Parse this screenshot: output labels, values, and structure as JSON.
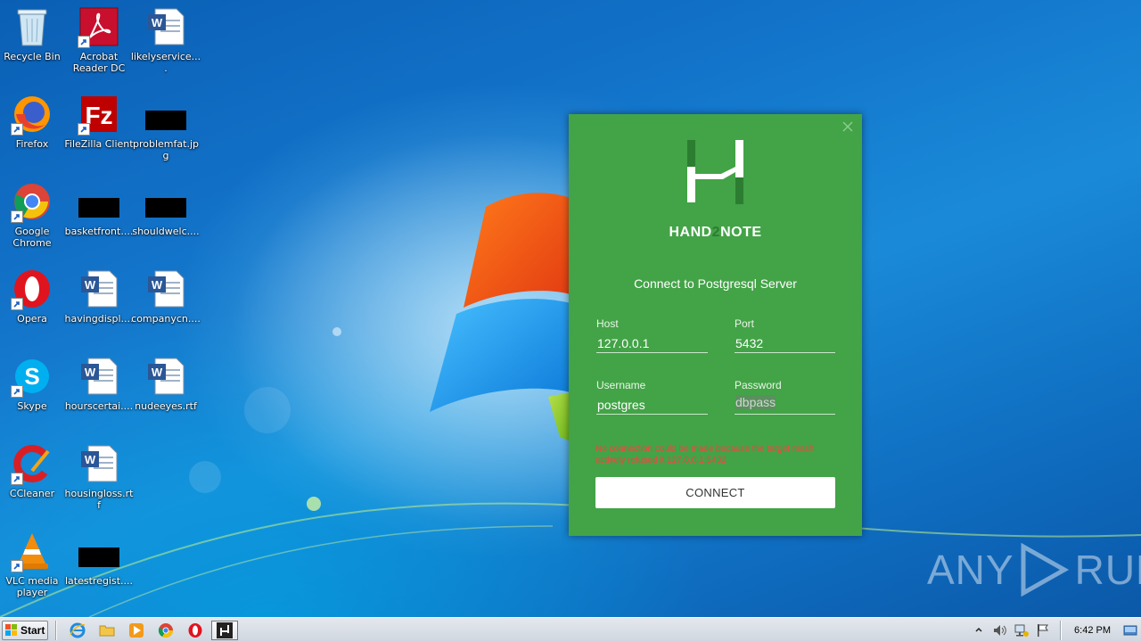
{
  "desktop": {
    "icons": [
      {
        "label": "Recycle Bin"
      },
      {
        "label": "Acrobat Reader DC"
      },
      {
        "label": "likelyservice...."
      },
      {
        "label": "Firefox"
      },
      {
        "label": "FileZilla Client"
      },
      {
        "label": "problemfat.jpg"
      },
      {
        "label": "Google Chrome"
      },
      {
        "label": "basketfront...."
      },
      {
        "label": "shouldwelc...."
      },
      {
        "label": "Opera"
      },
      {
        "label": "havingdispl...."
      },
      {
        "label": "companycn...."
      },
      {
        "label": "Skype"
      },
      {
        "label": "hourscertai...."
      },
      {
        "label": "nudeeyes.rtf"
      },
      {
        "label": "CCleaner"
      },
      {
        "label": "housingloss.rtf"
      },
      {
        "label": "VLC media player"
      },
      {
        "label": "latestregist...."
      }
    ]
  },
  "dialog": {
    "brand_prefix": "HAND",
    "brand_two": "2",
    "brand_suffix": "NOTE",
    "title": "Connect to Postgresql Server",
    "host": {
      "label": "Host",
      "value": "127.0.0.1"
    },
    "port": {
      "label": "Port",
      "value": "5432"
    },
    "username": {
      "label": "Username",
      "value": "postgres"
    },
    "password": {
      "label": "Password",
      "value": "dbpass"
    },
    "error": "No connection could be made because the target mash actively refused it 127.0.0.1:5432",
    "connect_label": "CONNECT",
    "accent_color": "#43a347"
  },
  "watermark": {
    "left": "ANY",
    "right": "RUN"
  },
  "taskbar": {
    "start_label": "Start",
    "pinned": [
      "internet-explorer",
      "file-explorer",
      "media-player",
      "chrome",
      "opera",
      "hand2note"
    ],
    "clock": "6:42 PM"
  }
}
